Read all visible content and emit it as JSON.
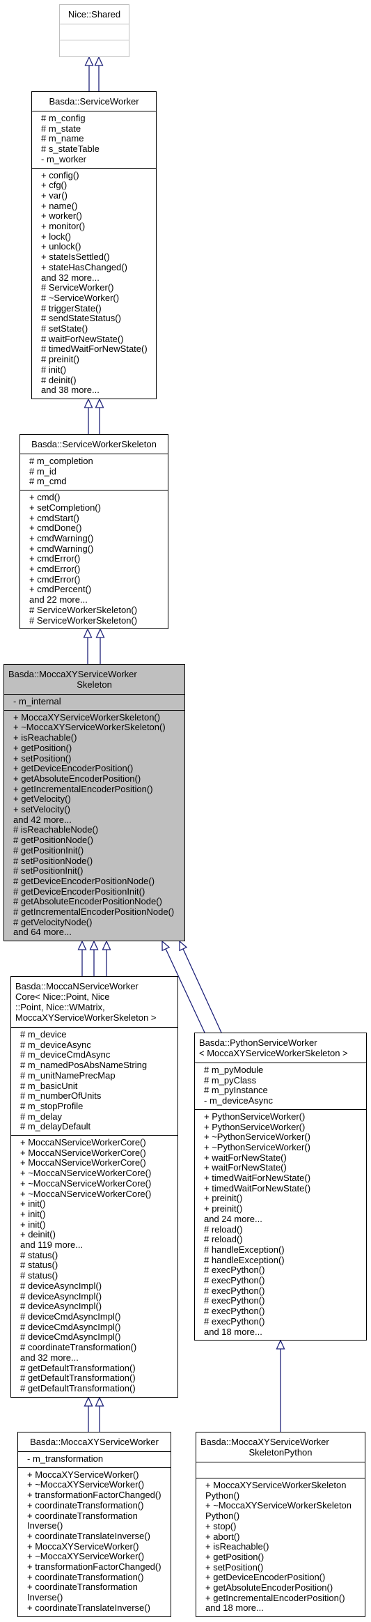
{
  "diagram": {
    "type": "class-inheritance-graph",
    "edge_color": "#1f237a",
    "current_class_fill": "#bfbfbf",
    "classes": {
      "nice_shared": {
        "title": [
          "Nice::Shared"
        ],
        "attributes": [],
        "methods": []
      },
      "service_worker": {
        "title": [
          "Basda::ServiceWorker"
        ],
        "attributes": [
          "# m_config",
          "# m_state",
          "# m_name",
          "# s_stateTable",
          "- m_worker"
        ],
        "methods": [
          "+ config()",
          "+ cfg()",
          "+ var()",
          "+ name()",
          "+ worker()",
          "+ monitor()",
          "+ lock()",
          "+ unlock()",
          "+ stateIsSettled()",
          "+ stateHasChanged()",
          "and 32 more...",
          "# ServiceWorker()",
          "# ~ServiceWorker()",
          "# triggerState()",
          "# sendStateStatus()",
          "# setState()",
          "# waitForNewState()",
          "# timedWaitForNewState()",
          "# preinit()",
          "# init()",
          "# deinit()",
          "and 38 more..."
        ]
      },
      "service_worker_skeleton": {
        "title": [
          "Basda::ServiceWorkerSkeleton"
        ],
        "attributes": [
          "# m_completion",
          "# m_id",
          "# m_cmd"
        ],
        "methods": [
          "+ cmd()",
          "+ setCompletion()",
          "+ cmdStart()",
          "+ cmdDone()",
          "+ cmdWarning()",
          "+ cmdWarning()",
          "+ cmdError()",
          "+ cmdError()",
          "+ cmdError()",
          "+ cmdPercent()",
          "and 22 more...",
          "# ServiceWorkerSkeleton()",
          "# ServiceWorkerSkeleton()"
        ]
      },
      "mocca_xy_skeleton": {
        "title": [
          "Basda::MoccaXYServiceWorker",
          "Skeleton"
        ],
        "attributes": [
          "- m_internal"
        ],
        "methods": [
          "+ MoccaXYServiceWorkerSkeleton()",
          "+ ~MoccaXYServiceWorkerSkeleton()",
          "+ isReachable()",
          "+ getPosition()",
          "+ setPosition()",
          "+ getDeviceEncoderPosition()",
          "+ getAbsoluteEncoderPosition()",
          "+ getIncrementalEncoderPosition()",
          "+ getVelocity()",
          "+ setVelocity()",
          "and 42 more...",
          "# isReachableNode()",
          "# getPositionNode()",
          "# getPositionInit()",
          "# setPositionNode()",
          "# setPositionInit()",
          "# getDeviceEncoderPositionNode()",
          "# getDeviceEncoderPositionInit()",
          "# getAbsoluteEncoderPositionNode()",
          "# getIncrementalEncoderPositionNode()",
          "# getVelocityNode()",
          "and 64 more..."
        ]
      },
      "mocca_n_core": {
        "title": [
          "Basda::MoccaNServiceWorker",
          "Core< Nice::Point, Nice",
          "::Point, Nice::WMatrix,",
          " MoccaXYServiceWorkerSkeleton >"
        ],
        "attributes": [
          "# m_device",
          "# m_deviceAsync",
          "# m_deviceCmdAsync",
          "# m_namedPosAbsNameString",
          "# m_unitNamePrecMap",
          "# m_basicUnit",
          "# m_numberOfUnits",
          "# m_stopProfile",
          "# m_delay",
          "# m_delayDefault"
        ],
        "methods": [
          "+ MoccaNServiceWorkerCore()",
          "+ MoccaNServiceWorkerCore()",
          "+ MoccaNServiceWorkerCore()",
          "+ ~MoccaNServiceWorkerCore()",
          "+ ~MoccaNServiceWorkerCore()",
          "+ ~MoccaNServiceWorkerCore()",
          "+ init()",
          "+ init()",
          "+ init()",
          "+ deinit()",
          "and 119 more...",
          "# status()",
          "# status()",
          "# status()",
          "# deviceAsyncImpl()",
          "# deviceAsyncImpl()",
          "# deviceAsyncImpl()",
          "# deviceCmdAsyncImpl()",
          "# deviceCmdAsyncImpl()",
          "# deviceCmdAsyncImpl()",
          "# coordinateTransformation()",
          "and 32 more...",
          "# getDefaultTransformation()",
          "# getDefaultTransformation()",
          "# getDefaultTransformation()"
        ]
      },
      "python_service_worker": {
        "title": [
          "Basda::PythonServiceWorker",
          "< MoccaXYServiceWorkerSkeleton >"
        ],
        "attributes": [
          "# m_pyModule",
          "# m_pyClass",
          "# m_pyInstance",
          "- m_deviceAsync"
        ],
        "methods": [
          "+ PythonServiceWorker()",
          "+ PythonServiceWorker()",
          "+ ~PythonServiceWorker()",
          "+ ~PythonServiceWorker()",
          "+ waitForNewState()",
          "+ waitForNewState()",
          "+ timedWaitForNewState()",
          "+ timedWaitForNewState()",
          "+ preinit()",
          "+ preinit()",
          "and 24 more...",
          "# reload()",
          "# reload()",
          "# handleException()",
          "# handleException()",
          "# execPython()",
          "# execPython()",
          "# execPython()",
          "# execPython()",
          "# execPython()",
          "# execPython()",
          "and 18 more..."
        ]
      },
      "mocca_xy_service_worker": {
        "title": [
          "Basda::MoccaXYServiceWorker"
        ],
        "attributes": [
          "- m_transformation"
        ],
        "methods": [
          "+ MoccaXYServiceWorker()",
          "+ ~MoccaXYServiceWorker()",
          "+ transformationFactorChanged()",
          "+ coordinateTransformation()",
          "+ coordinateTransformation",
          "Inverse()",
          "+ coordinateTranslateInverse()",
          "+ MoccaXYServiceWorker()",
          "+ ~MoccaXYServiceWorker()",
          "+ transformationFactorChanged()",
          "+ coordinateTransformation()",
          "+ coordinateTransformation",
          "Inverse()",
          "+ coordinateTranslateInverse()"
        ]
      },
      "mocca_xy_skeleton_python": {
        "title": [
          "Basda::MoccaXYServiceWorker",
          "SkeletonPython"
        ],
        "attributes": [],
        "methods": [
          "+ MoccaXYServiceWorkerSkeleton",
          "Python()",
          "+ ~MoccaXYServiceWorkerSkeleton",
          "Python()",
          "+ stop()",
          "+ abort()",
          "+ isReachable()",
          "+ getPosition()",
          "+ setPosition()",
          "+ getDeviceEncoderPosition()",
          "+ getAbsoluteEncoderPosition()",
          "+ getIncrementalEncoderPosition()",
          "and 18 more..."
        ]
      }
    }
  }
}
